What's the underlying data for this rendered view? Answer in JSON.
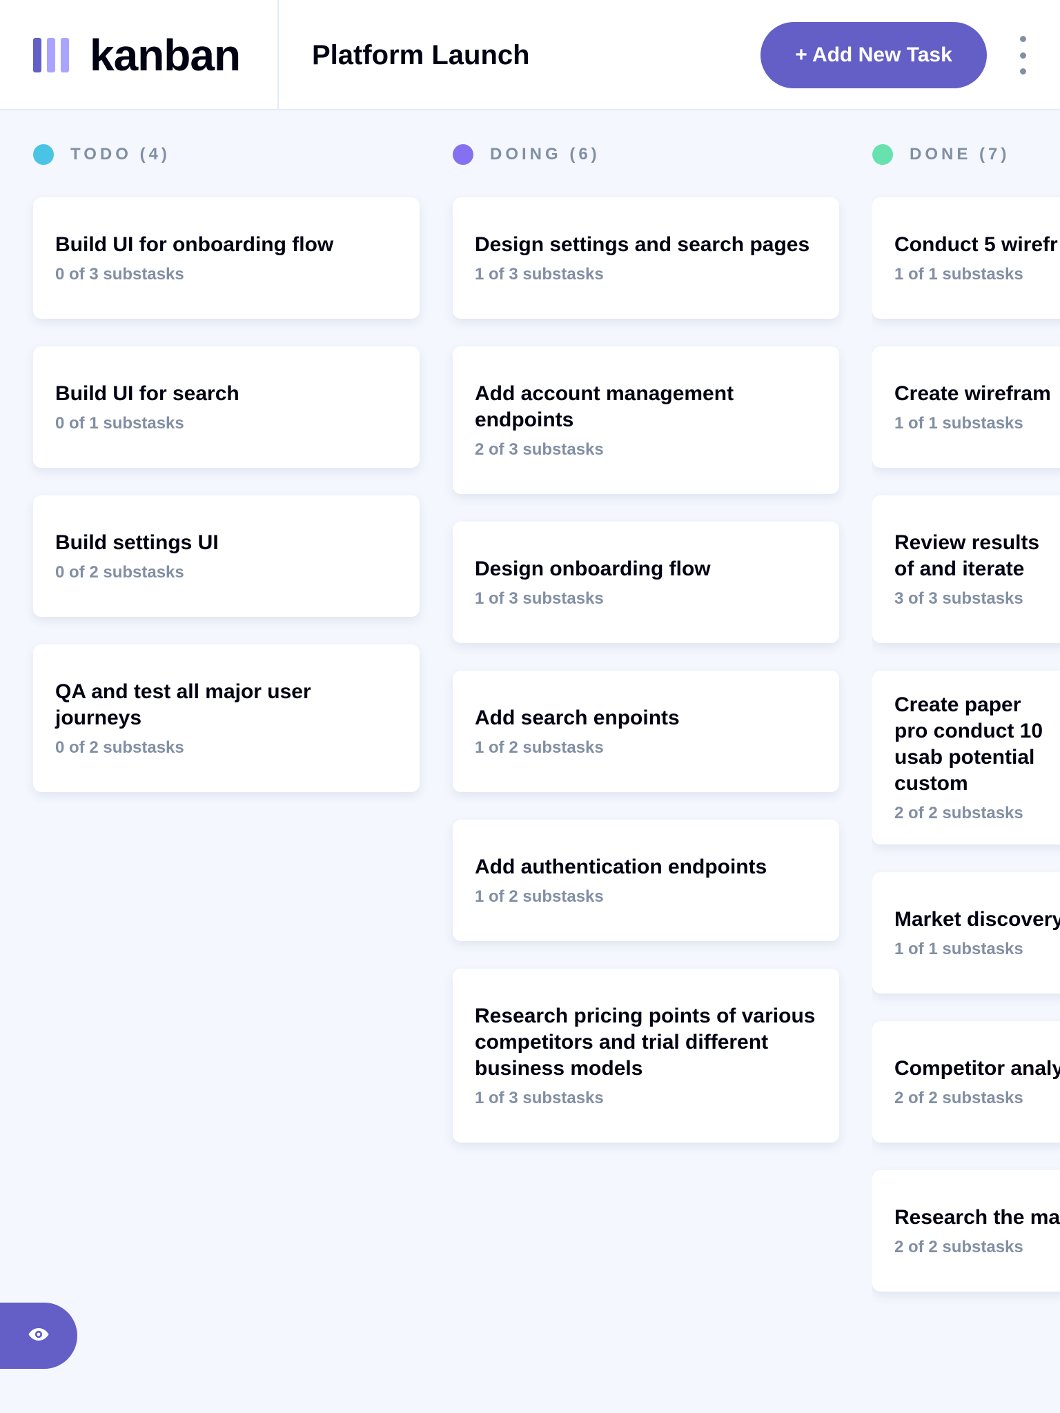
{
  "header": {
    "logo_text": "kanban",
    "board_title": "Platform Launch",
    "add_task_label": "+ Add New Task",
    "menu_icon": "vertical-ellipsis-icon",
    "logo_bar_colors": [
      "#635FC7",
      "#A8A4FF",
      "#A8A4FF"
    ]
  },
  "columns": [
    {
      "name": "TODO (4)",
      "dot_color": "#49C4E5",
      "tasks": [
        {
          "title": "Build UI for onboarding flow",
          "subtasks": "0 of 3 substasks"
        },
        {
          "title": "Build UI for search",
          "subtasks": "0 of 1 substasks"
        },
        {
          "title": "Build settings UI",
          "subtasks": "0 of 2 substasks"
        },
        {
          "title": "QA and test all major user journeys",
          "subtasks": "0 of 2 substasks"
        }
      ]
    },
    {
      "name": "DOING (6)",
      "dot_color": "#8471F2",
      "tasks": [
        {
          "title": "Design settings and search pages",
          "subtasks": "1 of 3 substasks"
        },
        {
          "title": "Add account management endpoints",
          "subtasks": "2 of 3 substasks"
        },
        {
          "title": "Design onboarding flow",
          "subtasks": "1 of 3 substasks"
        },
        {
          "title": "Add search enpoints",
          "subtasks": "1 of 2 substasks"
        },
        {
          "title": "Add authentication endpoints",
          "subtasks": "1 of 2 substasks"
        },
        {
          "title": "Research pricing points of various competitors and trial different business models",
          "subtasks": "1 of 3 substasks"
        }
      ]
    },
    {
      "name": "DONE (7)",
      "dot_color": "#67E2AE",
      "tasks": [
        {
          "title": "Conduct 5 wirefr",
          "subtasks": "1 of 1 substasks"
        },
        {
          "title": "Create wirefram",
          "subtasks": "1 of 1 substasks"
        },
        {
          "title": "Review results of and iterate",
          "subtasks": "3 of 3 substasks"
        },
        {
          "title": "Create paper pro conduct 10 usab potential custom",
          "subtasks": "2 of 2 substasks"
        },
        {
          "title": "Market discovery",
          "subtasks": "1 of 1 substasks"
        },
        {
          "title": "Competitor analy",
          "subtasks": "2 of 2 substasks"
        },
        {
          "title": "Research the ma",
          "subtasks": "2 of 2 substasks"
        }
      ]
    }
  ],
  "sidebar_toggle": {
    "icon": "eye-icon"
  }
}
